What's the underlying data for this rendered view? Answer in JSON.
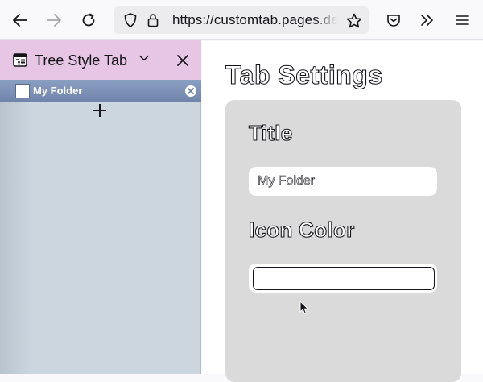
{
  "toolbar": {
    "back_icon": "arrow-left-icon",
    "forward_icon": "arrow-right-icon",
    "reload_icon": "reload-icon",
    "url": "https://customtab.pages.dev",
    "bookmark_icon": "star-icon",
    "pocket_icon": "pocket-icon",
    "overflow_icon": "chevrons-right-icon",
    "menu_icon": "hamburger-menu-icon"
  },
  "sidebar": {
    "title": "Tree Style Tab",
    "tabs": [
      {
        "label": "My Folder"
      }
    ]
  },
  "content": {
    "page_title": "Tab Settings",
    "title_section": "Title",
    "title_value": "My Folder",
    "icon_color_section": "Icon Color",
    "icon_color_value": "#ffffff"
  },
  "colors": {
    "sidebar_header": "#e7c5e4",
    "sidebar_bg": "#ccd6df",
    "tab_active": "#7a8fb3",
    "panel_bg": "#dadada"
  }
}
